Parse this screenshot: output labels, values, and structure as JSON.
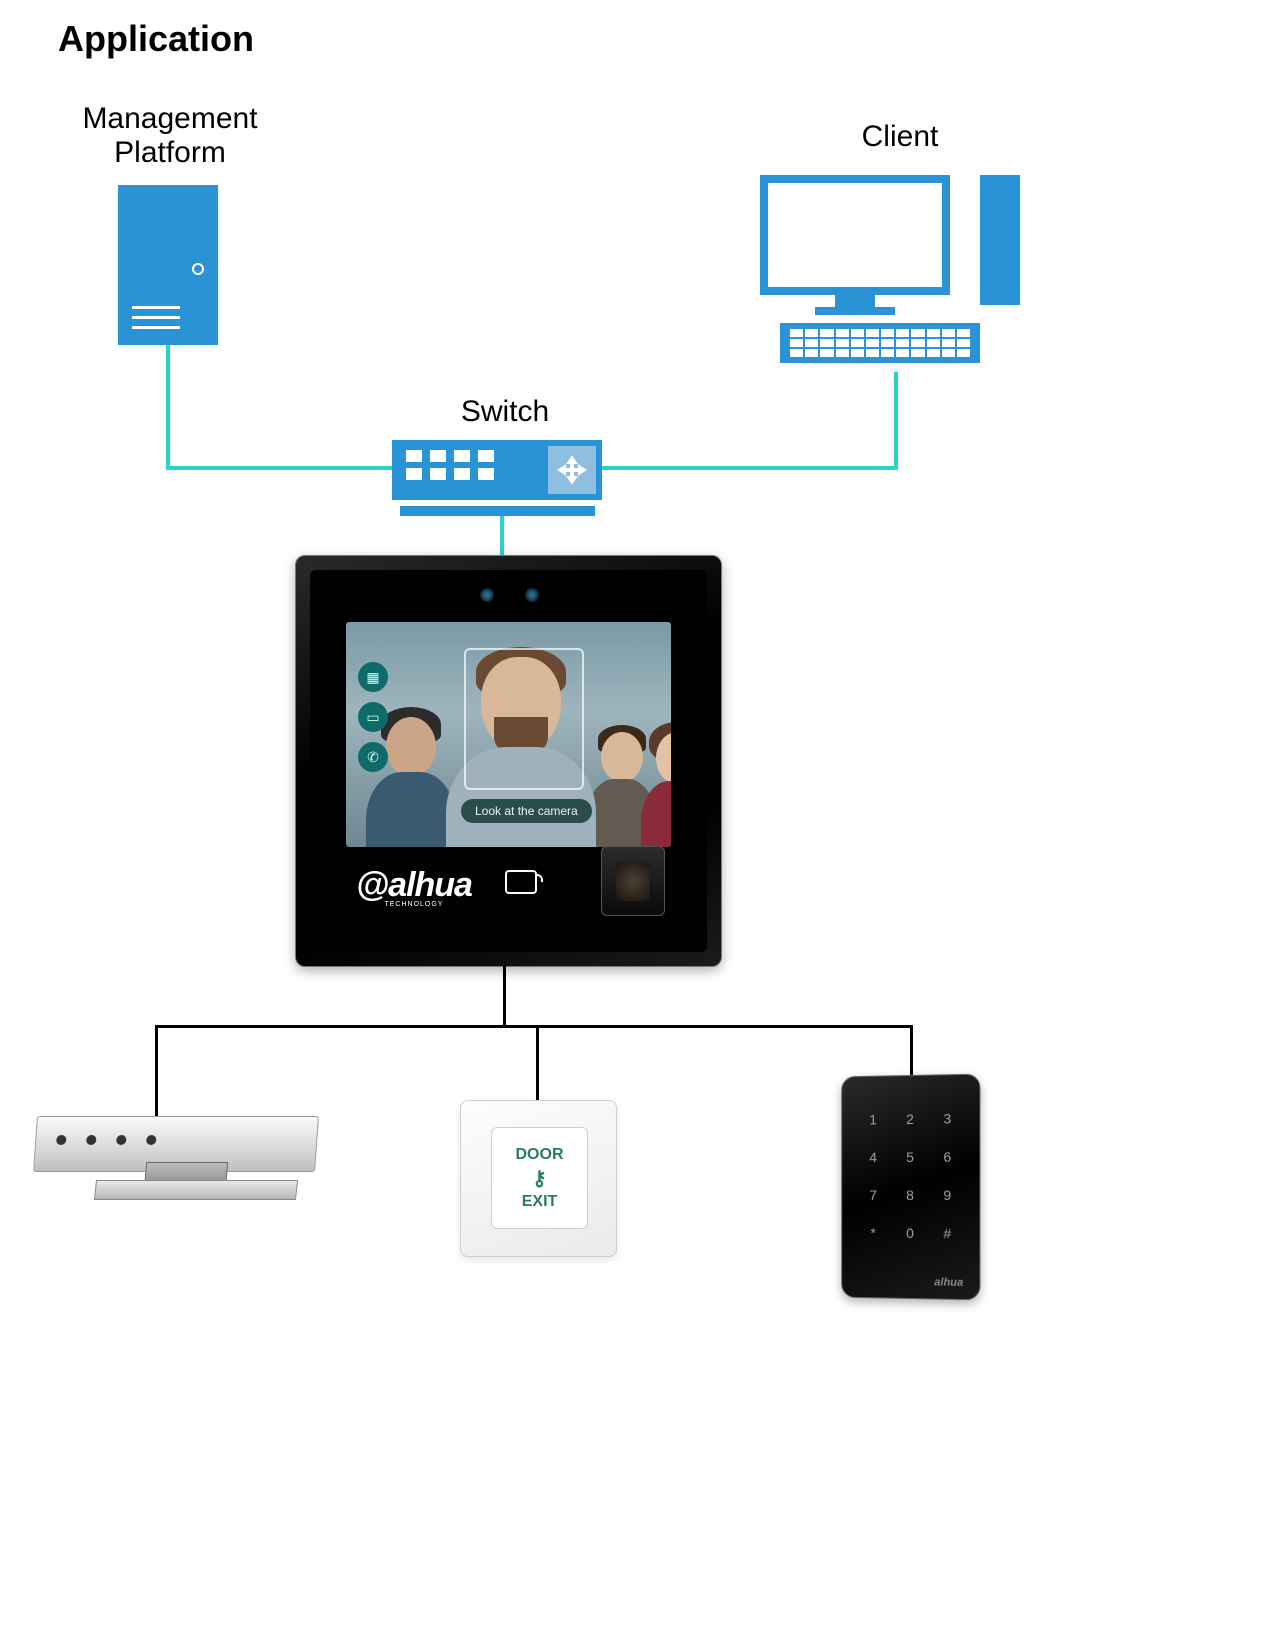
{
  "title": "Application",
  "labels": {
    "management_platform_l1": "Management",
    "management_platform_l2": "Platform",
    "client": "Client",
    "switch": "Switch"
  },
  "terminal": {
    "brand": "alhua",
    "brand_sub": "TECHNOLOGY",
    "screen_message": "Look at the camera"
  },
  "exit_button": {
    "line1": "DOOR",
    "line2": "EXIT"
  },
  "keypad": {
    "keys": [
      "1",
      "2",
      "3",
      "4",
      "5",
      "6",
      "7",
      "8",
      "9",
      "*",
      "0",
      "#"
    ],
    "brand": "alhua"
  },
  "colors": {
    "icon_blue": "#2a93d5",
    "wire_teal": "#26d5c9",
    "wire_black": "#000000"
  },
  "nodes": [
    {
      "id": "management-platform",
      "type": "server",
      "label": "Management Platform"
    },
    {
      "id": "client-pc",
      "type": "workstation",
      "label": "Client"
    },
    {
      "id": "network-switch",
      "type": "switch",
      "label": "Switch"
    },
    {
      "id": "face-terminal",
      "type": "face-recognition-access-controller",
      "brand": "alhua"
    },
    {
      "id": "magnetic-lock",
      "type": "electromagnetic-lock"
    },
    {
      "id": "door-exit-button",
      "type": "exit-button"
    },
    {
      "id": "card-keypad-reader",
      "type": "keypad-card-reader"
    }
  ],
  "connections": [
    {
      "from": "management-platform",
      "to": "network-switch",
      "medium": "ethernet"
    },
    {
      "from": "client-pc",
      "to": "network-switch",
      "medium": "ethernet"
    },
    {
      "from": "network-switch",
      "to": "face-terminal",
      "medium": "ethernet"
    },
    {
      "from": "face-terminal",
      "to": "magnetic-lock",
      "medium": "wired"
    },
    {
      "from": "face-terminal",
      "to": "door-exit-button",
      "medium": "wired"
    },
    {
      "from": "face-terminal",
      "to": "card-keypad-reader",
      "medium": "wired"
    }
  ]
}
